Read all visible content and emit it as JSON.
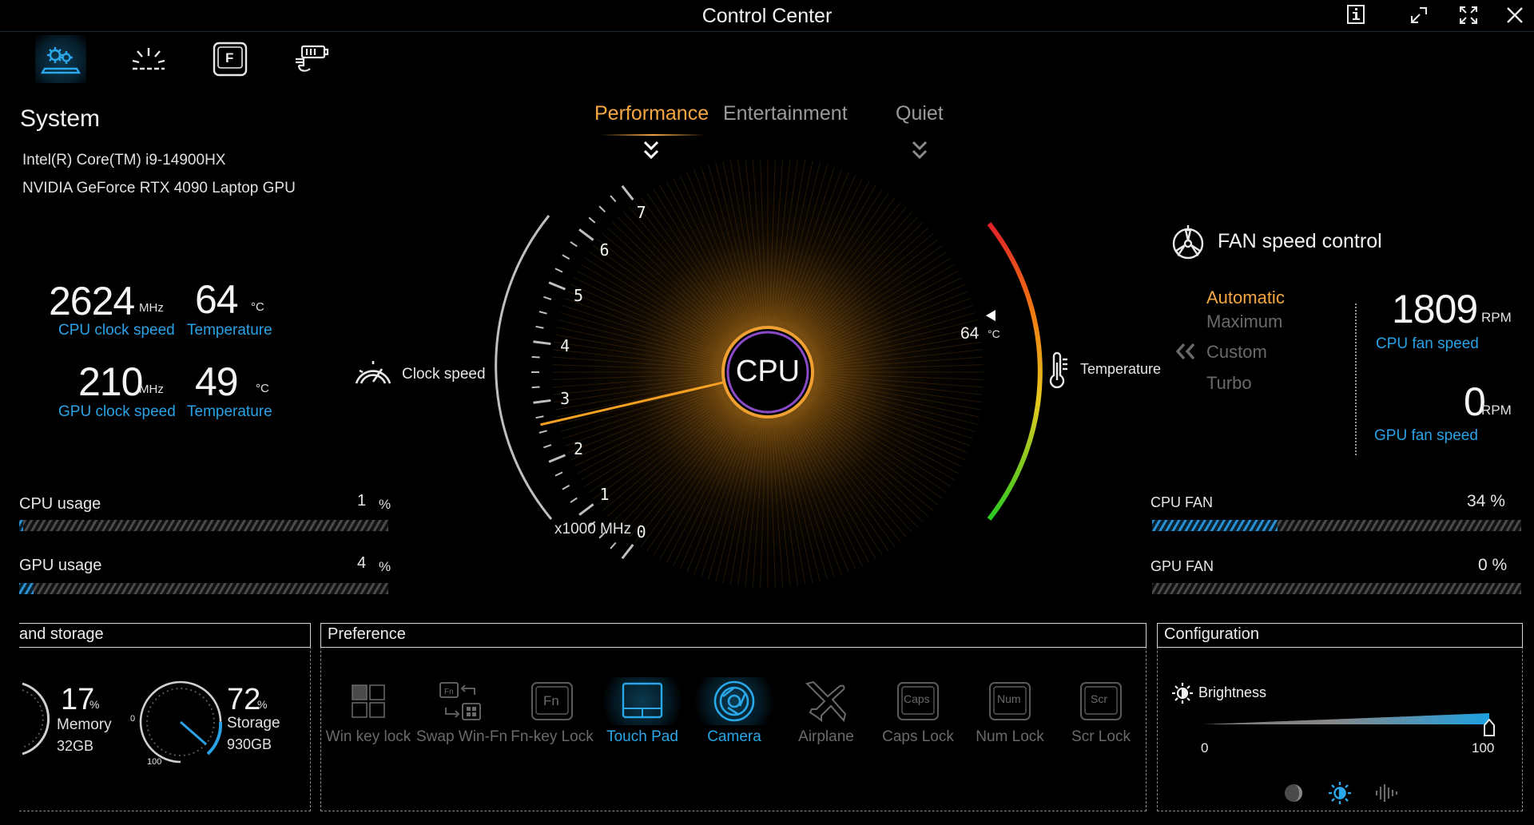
{
  "app": {
    "title": "Control Center"
  },
  "window_buttons": [
    "info-icon",
    "restore-icon",
    "maximize-icon",
    "close-icon"
  ],
  "tabs": [
    {
      "name": "system",
      "icon": "gears-laptop-icon"
    },
    {
      "name": "lighting",
      "icon": "lighting-icon"
    },
    {
      "name": "function-key",
      "icon": "function-key-icon"
    },
    {
      "name": "battery",
      "icon": "battery-plug-icon"
    }
  ],
  "system": {
    "title": "System",
    "cpu_name": "Intel(R) Core(TM) i9-14900HX",
    "gpu_name": "NVIDIA GeForce RTX 4090 Laptop GPU",
    "cpu_clock": "2624",
    "cpu_clock_unit": "MHz",
    "cpu_clock_label": "CPU clock speed",
    "cpu_temp": "64",
    "cpu_temp_unit": "°C",
    "cpu_temp_label": "Temperature",
    "gpu_clock": "210",
    "gpu_clock_unit": "MHz",
    "gpu_clock_label": "GPU clock speed",
    "gpu_temp": "49",
    "gpu_temp_unit": "°C",
    "gpu_temp_label": "Temperature",
    "cpu_usage_label": "CPU usage",
    "cpu_usage": "1",
    "cpu_usage_pct": 1,
    "gpu_usage_label": "GPU usage",
    "gpu_usage": "4",
    "gpu_usage_pct": 4,
    "percent": "%"
  },
  "modes": {
    "performance": "Performance",
    "entertainment": "Entertainment",
    "quiet": "Quiet"
  },
  "gauge": {
    "center_label": "CPU",
    "clock_speed_label": "Clock speed",
    "temperature_label": "Temperature",
    "temperature_value": "64",
    "temperature_unit": "°C",
    "scale_unit": "x1000 MHz",
    "ticks": [
      "0",
      "1",
      "2",
      "3",
      "4",
      "5",
      "6",
      "7"
    ],
    "clock_value_ghz": 2.624,
    "temperature_fraction": 0.64
  },
  "fan": {
    "title": "FAN speed control",
    "modes": {
      "automatic": "Automatic",
      "maximum": "Maximum",
      "custom": "Custom",
      "turbo": "Turbo"
    },
    "cpu_rpm": "1809",
    "rpm_unit": "RPM",
    "cpu_rpm_label": "CPU fan speed",
    "gpu_rpm": "0",
    "gpu_rpm_label": "GPU fan speed",
    "cpu_fan_label": "CPU FAN",
    "cpu_fan_value": "34 %",
    "cpu_fan_pct": 34,
    "gpu_fan_label": "GPU FAN",
    "gpu_fan_value": "0 %",
    "gpu_fan_pct": 0
  },
  "storage": {
    "header": "and storage",
    "memory_pct": "17",
    "memory_label": "Memory",
    "memory_size": "32GB",
    "storage_pct": "72",
    "storage_label": "Storage",
    "storage_size": "930GB",
    "pct_unit": "%",
    "dial_min": "0",
    "dial_max": "100",
    "storage_fraction": 0.72
  },
  "preference": {
    "header": "Preference",
    "items": [
      {
        "label": "Win key lock",
        "active": false
      },
      {
        "label": "Swap Win-Fn",
        "active": false
      },
      {
        "label": "Fn-key Lock",
        "active": false
      },
      {
        "label": "Touch Pad",
        "active": true
      },
      {
        "label": "Camera",
        "active": true
      },
      {
        "label": "Airplane",
        "active": false
      },
      {
        "label": "Caps Lock",
        "active": false
      },
      {
        "label": "Num Lock",
        "active": false
      },
      {
        "label": "Scr Lock",
        "active": false
      }
    ],
    "key_caps": {
      "fn": "Fn",
      "caps": "Caps",
      "num": "Num",
      "scr": "Scr"
    }
  },
  "configuration": {
    "header": "Configuration",
    "brightness_label": "Brightness",
    "min": "0",
    "max": "100",
    "brightness_value": 100
  },
  "colors": {
    "accent_orange": "#f5a742",
    "accent_blue": "#2aa2e6",
    "bg": "#000000"
  }
}
